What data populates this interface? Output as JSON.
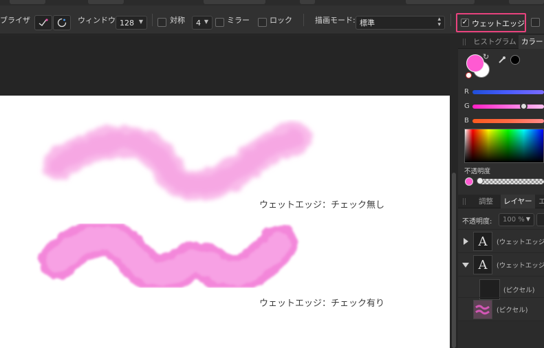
{
  "toolbar": {
    "stabilizer_label": "ブライザ",
    "window_label": "ウィンドウ:",
    "window_value": "128",
    "symmetry_label": "対称",
    "symmetry_value": "4",
    "mirror_label": "ミラー",
    "lock_label": "ロック",
    "blend_mode_label": "描画モード:",
    "blend_mode_value": "標準",
    "wet_edges_label": "ウェットエッジ",
    "wet_edges_checked": true,
    "wet_edges_check_glyph": "✓"
  },
  "canvas": {
    "label_without": "ウェットエッジ：チェック無し",
    "label_with": "ウェットエッジ：チェック有り",
    "stroke_color": "#f27ad6"
  },
  "color_panel": {
    "tabs": [
      "ヒストグラム",
      "カラー"
    ],
    "active_tab": "カラー",
    "channels": [
      "R",
      "G",
      "B"
    ],
    "green_value_fraction": 0.72,
    "primary_color": "#ff5ad2",
    "secondary_color": "#ffffff",
    "opacity_label": "不透明度"
  },
  "layers_panel": {
    "tabs": [
      "調整",
      "レイヤー",
      "エ"
    ],
    "active_tab": "レイヤー",
    "opacity_label": "不透明度:",
    "opacity_value": "100 %",
    "layers": [
      {
        "name": "(ウェットエッジ",
        "thumb": "A",
        "expander": "collapsed"
      },
      {
        "name": "(ウェットエッジ",
        "thumb": "A",
        "expander": "expanded"
      },
      {
        "name": "(ピクセル)",
        "thumb": "",
        "expander": "none"
      },
      {
        "name": "(ピクセル)",
        "thumb": "stroke",
        "expander": "none"
      }
    ]
  },
  "colors": {
    "toolbar_bg": "#313131",
    "panel_bg": "#2e2e2e",
    "highlight": "#e9437e"
  }
}
